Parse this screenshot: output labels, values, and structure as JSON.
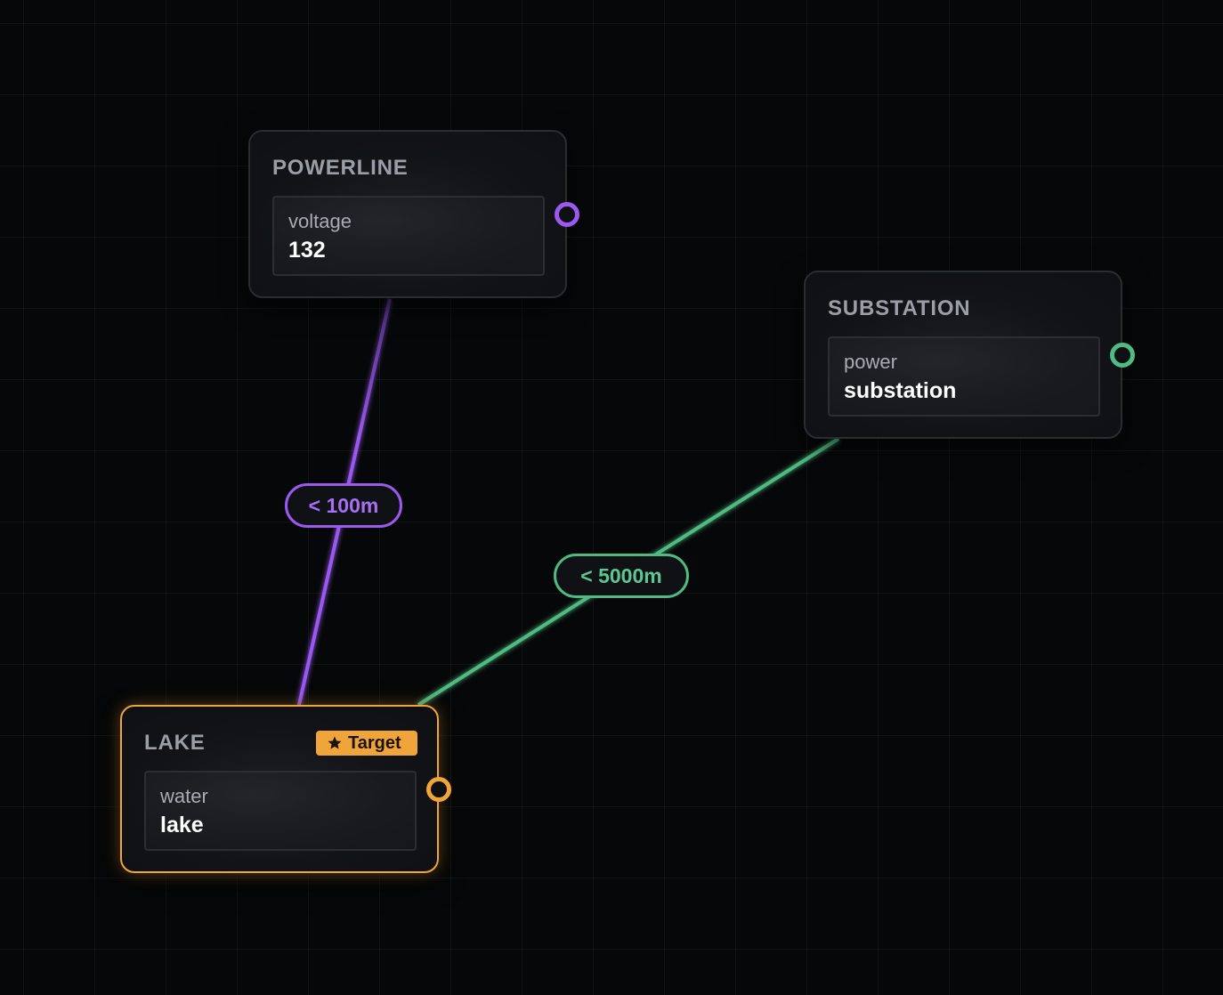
{
  "nodes": {
    "powerline": {
      "title": "POWERLINE",
      "field_key": "voltage",
      "field_value": "132",
      "handle_color": "#9b59f0"
    },
    "substation": {
      "title": "SUBSTATION",
      "field_key": "power",
      "field_value": "substation",
      "handle_color": "#4fba82"
    },
    "lake": {
      "title": "LAKE",
      "badge": "Target",
      "badge_icon": "star-icon",
      "field_key": "water",
      "field_value": "lake",
      "handle_color": "#f0a53a",
      "selected": true
    }
  },
  "edges": [
    {
      "from": "powerline",
      "to": "lake",
      "label": "< 100m",
      "color": "#9b59f0"
    },
    {
      "from": "substation",
      "to": "lake",
      "label": "< 5000m",
      "color": "#4fba82"
    }
  ]
}
